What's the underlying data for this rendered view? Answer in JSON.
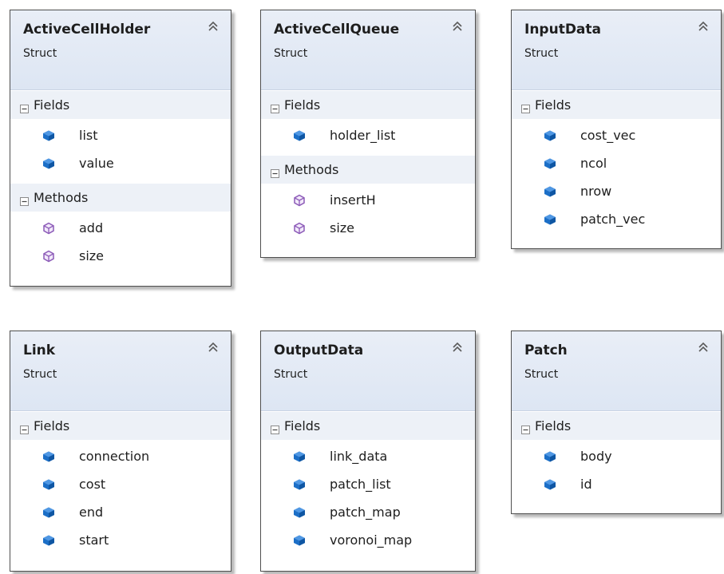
{
  "diagram": {
    "structs": [
      {
        "name": "ActiveCellHolder",
        "kind": "Struct",
        "sections": [
          {
            "label": "Fields",
            "members": [
              {
                "label": "list",
                "icon": "field-icon"
              },
              {
                "label": "value",
                "icon": "field-icon"
              }
            ]
          },
          {
            "label": "Methods",
            "members": [
              {
                "label": "add",
                "icon": "method-icon"
              },
              {
                "label": "size",
                "icon": "method-icon"
              }
            ]
          }
        ]
      },
      {
        "name": "ActiveCellQueue",
        "kind": "Struct",
        "sections": [
          {
            "label": "Fields",
            "members": [
              {
                "label": "holder_list",
                "icon": "field-icon"
              }
            ]
          },
          {
            "label": "Methods",
            "members": [
              {
                "label": "insertH",
                "icon": "method-icon"
              },
              {
                "label": "size",
                "icon": "method-icon"
              }
            ]
          }
        ]
      },
      {
        "name": "InputData",
        "kind": "Struct",
        "sections": [
          {
            "label": "Fields",
            "members": [
              {
                "label": "cost_vec",
                "icon": "field-icon"
              },
              {
                "label": "ncol",
                "icon": "field-icon"
              },
              {
                "label": "nrow",
                "icon": "field-icon"
              },
              {
                "label": "patch_vec",
                "icon": "field-icon"
              }
            ]
          }
        ]
      },
      {
        "name": "Link",
        "kind": "Struct",
        "sections": [
          {
            "label": "Fields",
            "members": [
              {
                "label": "connection",
                "icon": "field-icon"
              },
              {
                "label": "cost",
                "icon": "field-icon"
              },
              {
                "label": "end",
                "icon": "field-icon"
              },
              {
                "label": "start",
                "icon": "field-icon"
              }
            ]
          }
        ]
      },
      {
        "name": "OutputData",
        "kind": "Struct",
        "sections": [
          {
            "label": "Fields",
            "members": [
              {
                "label": "link_data",
                "icon": "field-icon"
              },
              {
                "label": "patch_list",
                "icon": "field-icon"
              },
              {
                "label": "patch_map",
                "icon": "field-icon"
              },
              {
                "label": "voronoi_map",
                "icon": "field-icon"
              }
            ]
          }
        ]
      },
      {
        "name": "Patch",
        "kind": "Struct",
        "sections": [
          {
            "label": "Fields",
            "members": [
              {
                "label": "body",
                "icon": "field-icon"
              },
              {
                "label": "id",
                "icon": "field-icon"
              }
            ]
          }
        ]
      }
    ],
    "colors": {
      "field_icon": "#1c6fc7",
      "method_icon": "#8c5bb8",
      "header_bg": "#dde6f3",
      "section_bg": "#edf1f7"
    }
  }
}
